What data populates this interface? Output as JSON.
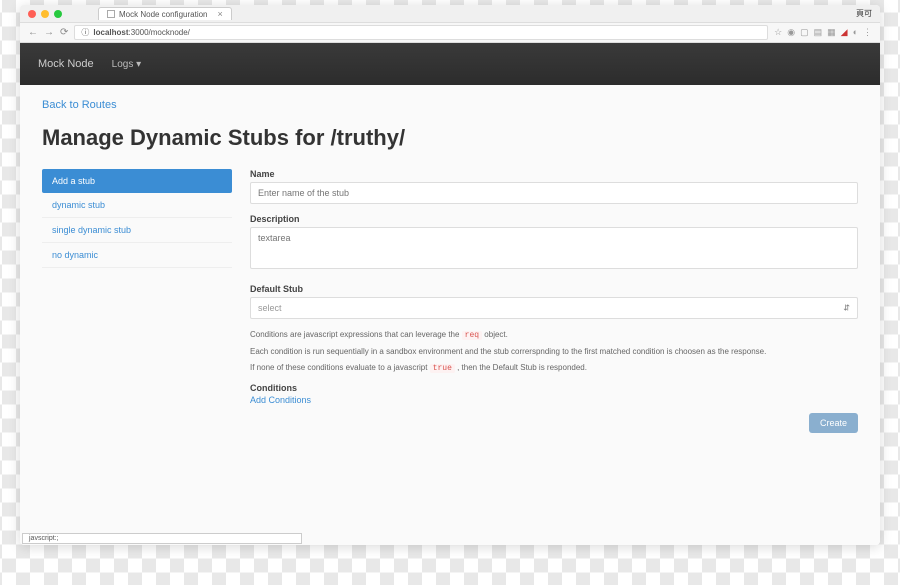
{
  "browser": {
    "tab_title": "Mock Node configuration",
    "url_host": "localhost",
    "url_port_path": ":3000/mocknode/",
    "titlebar_right": "頁可",
    "statusbar": "javscript:;"
  },
  "header": {
    "brand": "Mock Node",
    "nav_logs": "Logs"
  },
  "page": {
    "back_link": "Back to Routes",
    "title": "Manage Dynamic Stubs for /truthy/"
  },
  "sidebar": {
    "items": [
      {
        "label": "Add a stub",
        "active": true
      },
      {
        "label": "dynamic stub",
        "active": false
      },
      {
        "label": "single dynamic stub",
        "active": false
      },
      {
        "label": "no dynamic",
        "active": false
      }
    ]
  },
  "form": {
    "name_label": "Name",
    "name_placeholder": "Enter name of the stub",
    "description_label": "Description",
    "description_placeholder": "textarea",
    "default_stub_label": "Default Stub",
    "default_stub_value": "select",
    "help_line1_pre": "Conditions are javascript expressions that can leverage the ",
    "help_line1_code": "req",
    "help_line1_post": " object.",
    "help_line2": "Each condition is run sequentially in a sandbox environment and the stub correrspnding to the first matched condition is choosen as the response.",
    "help_line3_pre": "If none of these conditions evaluate to a javascript ",
    "help_line3_code": "true",
    "help_line3_post": " , then the Default Stub is responded.",
    "conditions_label": "Conditions",
    "add_conditions": "Add Conditions",
    "create_button": "Create"
  }
}
